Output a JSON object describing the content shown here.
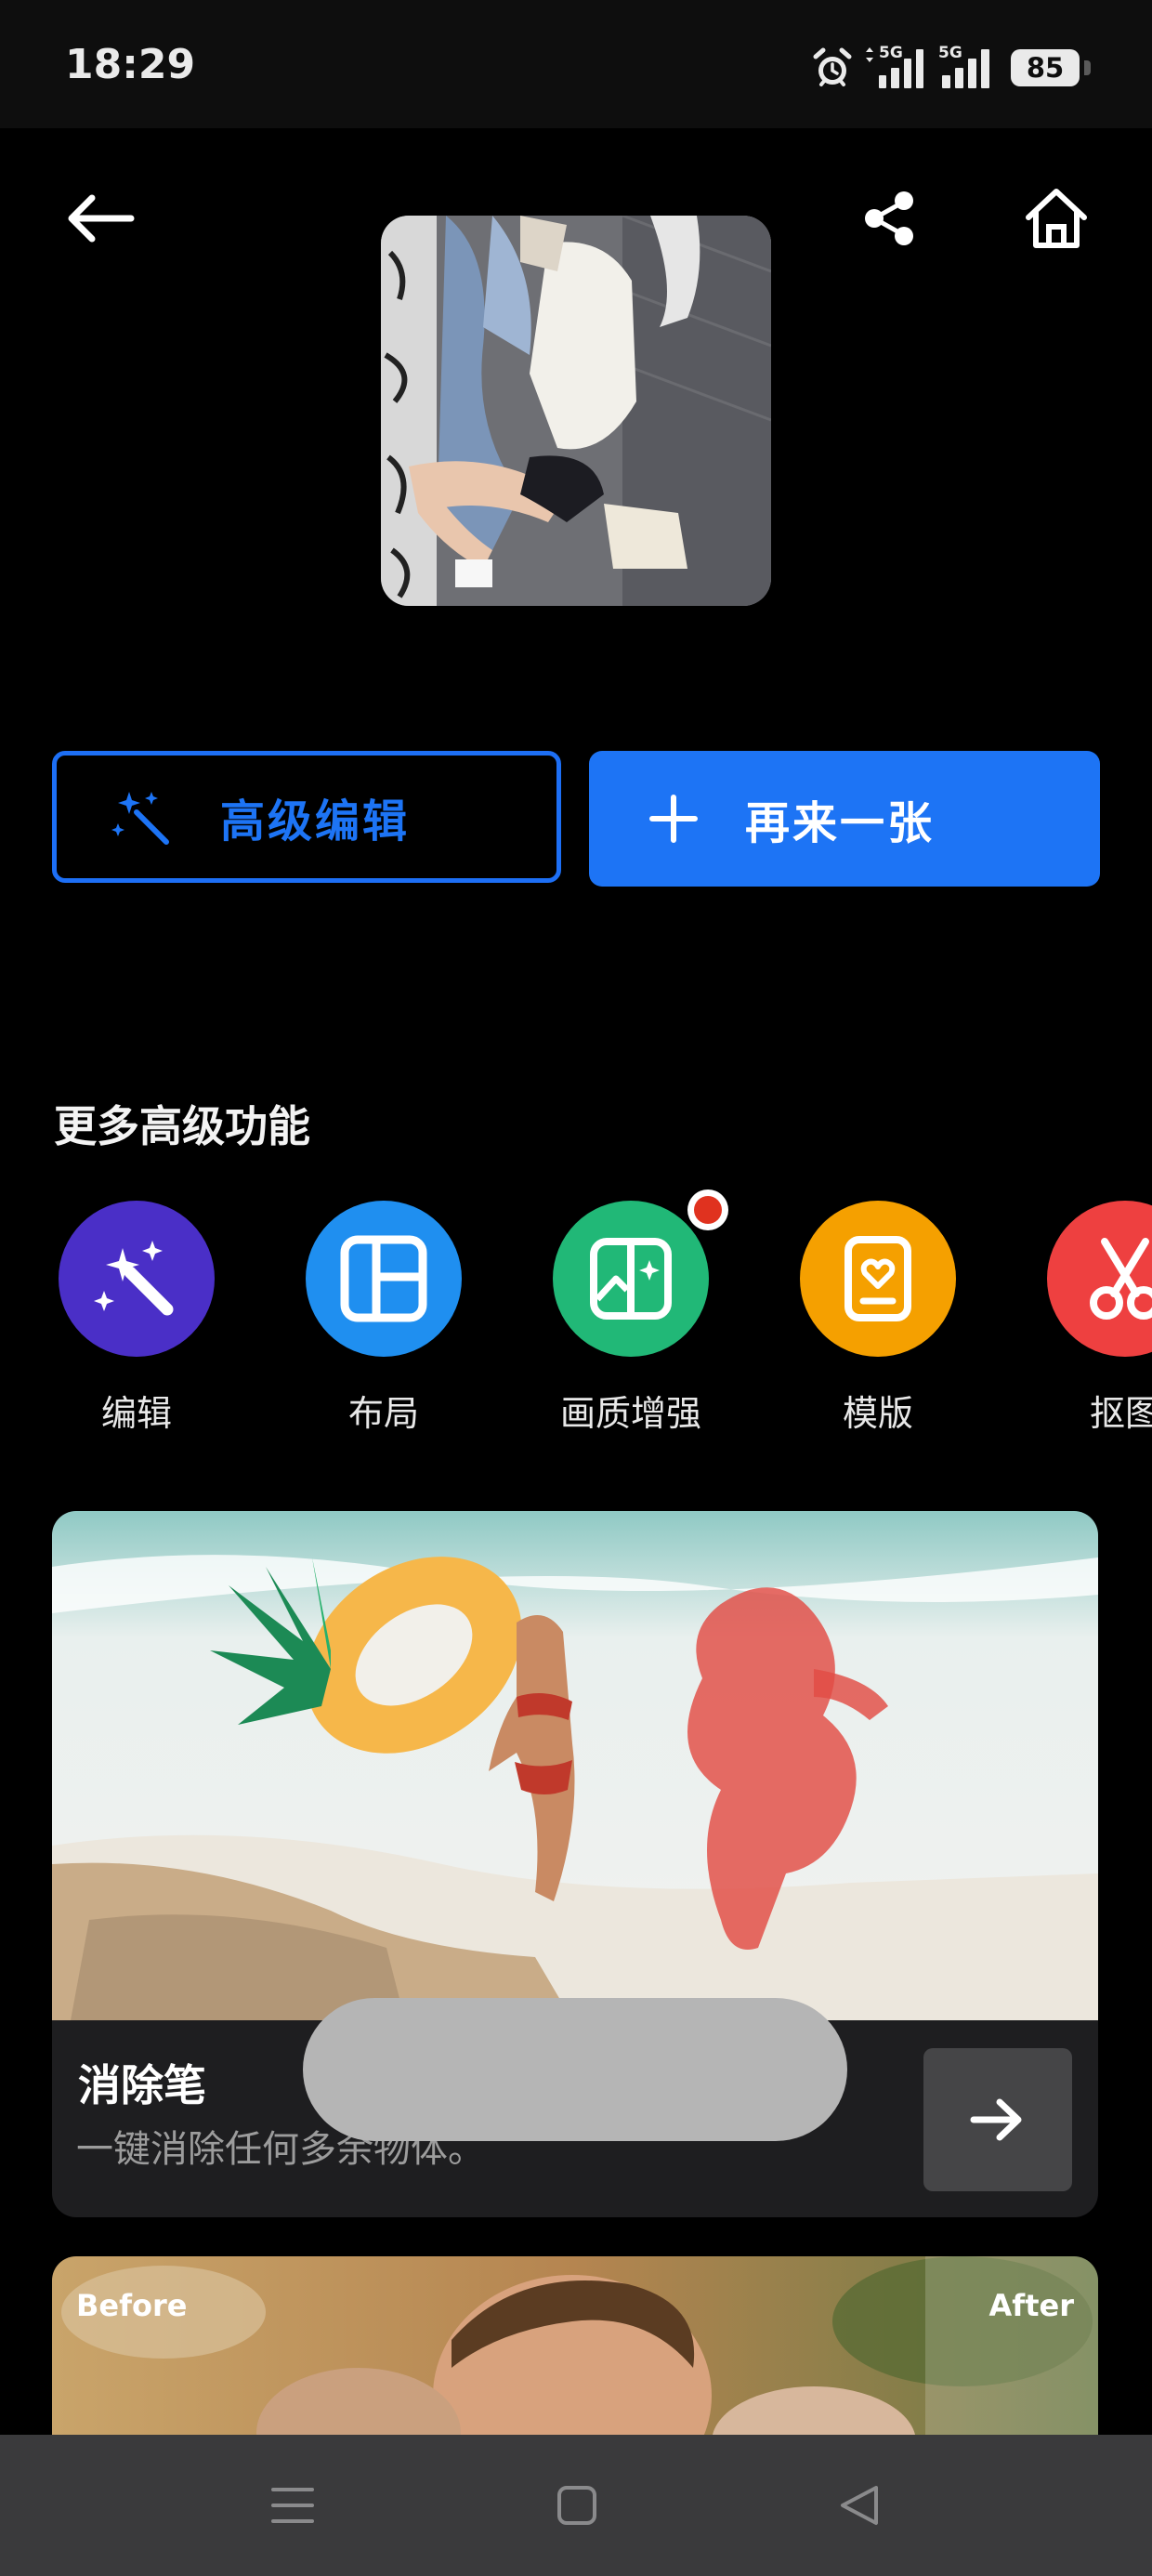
{
  "status_bar": {
    "time": "18:29",
    "signal_1_label": "5G",
    "signal_2_label": "5G",
    "battery": "85",
    "icons": [
      "alarm-icon",
      "signal-icon",
      "battery-icon"
    ]
  },
  "top_nav": {
    "icons": [
      "back-arrow-icon",
      "share-icon",
      "home-icon"
    ]
  },
  "actions": {
    "advanced_edit_label": "高级编辑",
    "again_label": "再来一张"
  },
  "more": {
    "title": "更多高级功能",
    "features": [
      {
        "label": "编辑",
        "icon": "magic-wand-icon",
        "color": "#4a2fc7"
      },
      {
        "label": "布局",
        "icon": "layout-icon",
        "color": "#1f8ff0"
      },
      {
        "label": "画质增强",
        "icon": "enhance-icon",
        "color": "#21b877",
        "badge": true
      },
      {
        "label": "模版",
        "icon": "template-icon",
        "color": "#f5a000"
      },
      {
        "label": "抠图",
        "icon": "cutout-scissors-icon",
        "color": "#ee4040"
      }
    ]
  },
  "eraser_card": {
    "title": "消除笔",
    "description": "一键消除任何多余物体。"
  },
  "before_after_card": {
    "before": "Before",
    "after": "After"
  },
  "colors": {
    "accent": "#1d74f5",
    "background": "#000000",
    "card": "#1e1e20"
  }
}
